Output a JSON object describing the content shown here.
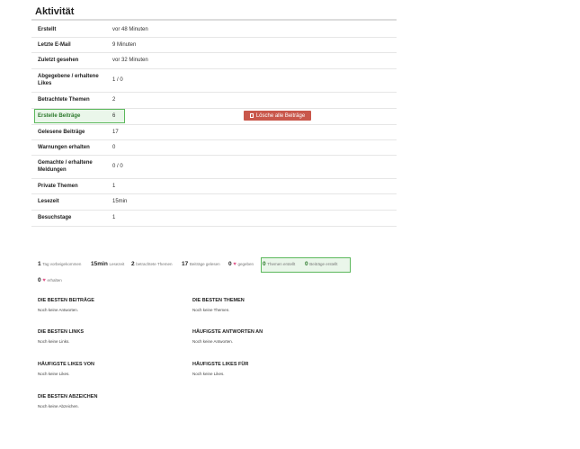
{
  "page": {
    "title": "Aktivität"
  },
  "activity_rows": [
    {
      "label": "Erstellt",
      "value": "vor 48 Minuten"
    },
    {
      "label": "Letzte E-Mail",
      "value": "9 Minuten"
    },
    {
      "label": "Zuletzt gesehen",
      "value": "vor 32 Minuten"
    },
    {
      "label": "Abgegebene / erhaltene Likes",
      "value": "1 / 0"
    },
    {
      "label": "Betrachtete Themen",
      "value": "2"
    },
    {
      "label": "Erstelle Beiträge",
      "value": "6"
    },
    {
      "label": "Gelesene Beiträge",
      "value": "17"
    },
    {
      "label": "Warnungen erhalten",
      "value": "0"
    },
    {
      "label": "Gemachte / erhaltene Meldungen",
      "value": "0 / 0"
    },
    {
      "label": "Private Themen",
      "value": "1"
    },
    {
      "label": "Lesezeit",
      "value": "15min"
    },
    {
      "label": "Besuchstage",
      "value": "1"
    }
  ],
  "delete_button": {
    "label": "Lösche alle Beiträge",
    "icon": "trash-icon"
  },
  "stats": [
    {
      "value": "1",
      "label": "Tag vorbeigekommen"
    },
    {
      "value": "15min",
      "label": "Lesezeit"
    },
    {
      "value": "2",
      "label": "betrachtete Themen"
    },
    {
      "value": "17",
      "label": "Beiträge gelesen"
    },
    {
      "value": "0",
      "label": "gegeben",
      "icon": "heart-icon"
    },
    {
      "value": "0",
      "label": "Themen erstellt"
    },
    {
      "value": "0",
      "label": "Beiträge erstellt"
    },
    {
      "value": "0",
      "label": "erhalten",
      "icon": "heart-icon"
    }
  ],
  "sections": [
    {
      "heading": "DIE BESTEN BEITRÄGE",
      "text": "Noch keine Antworten."
    },
    {
      "heading": "DIE BESTEN THEMEN",
      "text": "Noch keine Themen."
    },
    {
      "heading": "DIE BESTEN LINKS",
      "text": "Noch keine Links."
    },
    {
      "heading": "HÄUFIGSTE ANTWORTEN AN",
      "text": "Noch keine Antworten."
    },
    {
      "heading": "HÄUFIGSTE LIKES VON",
      "text": "Noch keine Likes."
    },
    {
      "heading": "HÄUFIGSTE LIKES FÜR",
      "text": "Noch keine Likes."
    },
    {
      "heading": "DIE BESTEN ABZEICHEN",
      "text": "Noch keine Abzeichen."
    }
  ],
  "colors": {
    "accent_green": "#5cb85c",
    "danger": "#c9574b",
    "heart": "#e05a8b"
  }
}
